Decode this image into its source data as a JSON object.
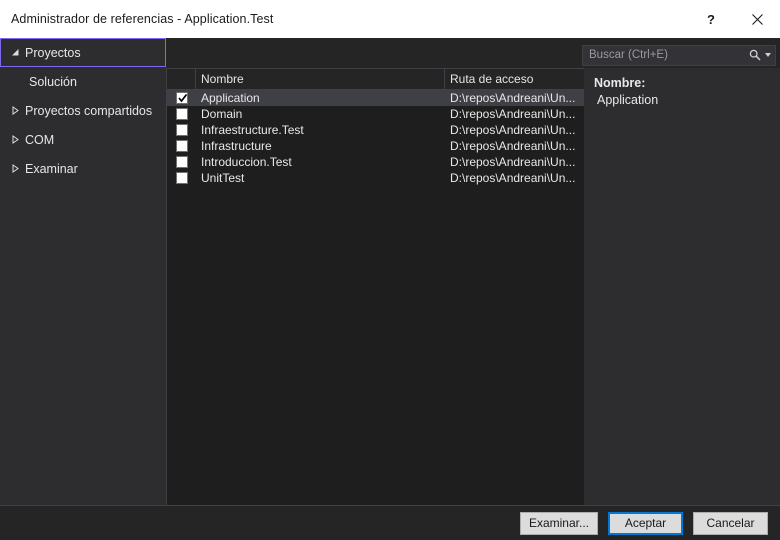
{
  "window": {
    "title": "Administrador de referencias - Application.Test",
    "help_icon": "question-mark-icon",
    "close_icon": "close-icon"
  },
  "sidebar": {
    "items": [
      {
        "label": "Proyectos",
        "expanded": true,
        "focused": true,
        "child": false
      },
      {
        "label": "Solución",
        "expanded": false,
        "focused": false,
        "child": true
      },
      {
        "label": "Proyectos compartidos",
        "expanded": false,
        "focused": false,
        "child": false
      },
      {
        "label": "COM",
        "expanded": false,
        "focused": false,
        "child": false
      },
      {
        "label": "Examinar",
        "expanded": false,
        "focused": false,
        "child": false
      }
    ]
  },
  "search": {
    "placeholder": "Buscar (Ctrl+E)",
    "value": "",
    "icon": "search-icon",
    "dropdown_icon": "chevron-down-icon"
  },
  "list": {
    "columns": [
      "",
      "Nombre",
      "Ruta de acceso"
    ],
    "rows": [
      {
        "checked": true,
        "name": "Application",
        "path": "D:\\repos\\Andreani\\Un...",
        "selected": true
      },
      {
        "checked": false,
        "name": "Domain",
        "path": "D:\\repos\\Andreani\\Un...",
        "selected": false
      },
      {
        "checked": false,
        "name": "Infraestructure.Test",
        "path": "D:\\repos\\Andreani\\Un...",
        "selected": false
      },
      {
        "checked": false,
        "name": "Infrastructure",
        "path": "D:\\repos\\Andreani\\Un...",
        "selected": false
      },
      {
        "checked": false,
        "name": "Introduccion.Test",
        "path": "D:\\repos\\Andreani\\Un...",
        "selected": false
      },
      {
        "checked": false,
        "name": "UnitTest",
        "path": "D:\\repos\\Andreani\\Un...",
        "selected": false
      }
    ]
  },
  "detail": {
    "name_label": "Nombre:",
    "name_value": "Application"
  },
  "footer": {
    "browse_label": "Examinar...",
    "accept_label": "Aceptar",
    "cancel_label": "Cancelar"
  },
  "colors": {
    "titlebar_bg": "#ffffff",
    "dialog_bg": "#252526",
    "panel_bg": "#2d2d30",
    "list_bg": "#1e1e1e",
    "selection": "#3f3f46",
    "focus_purple": "#7c69ef",
    "default_button_blue": "#0078d7"
  }
}
